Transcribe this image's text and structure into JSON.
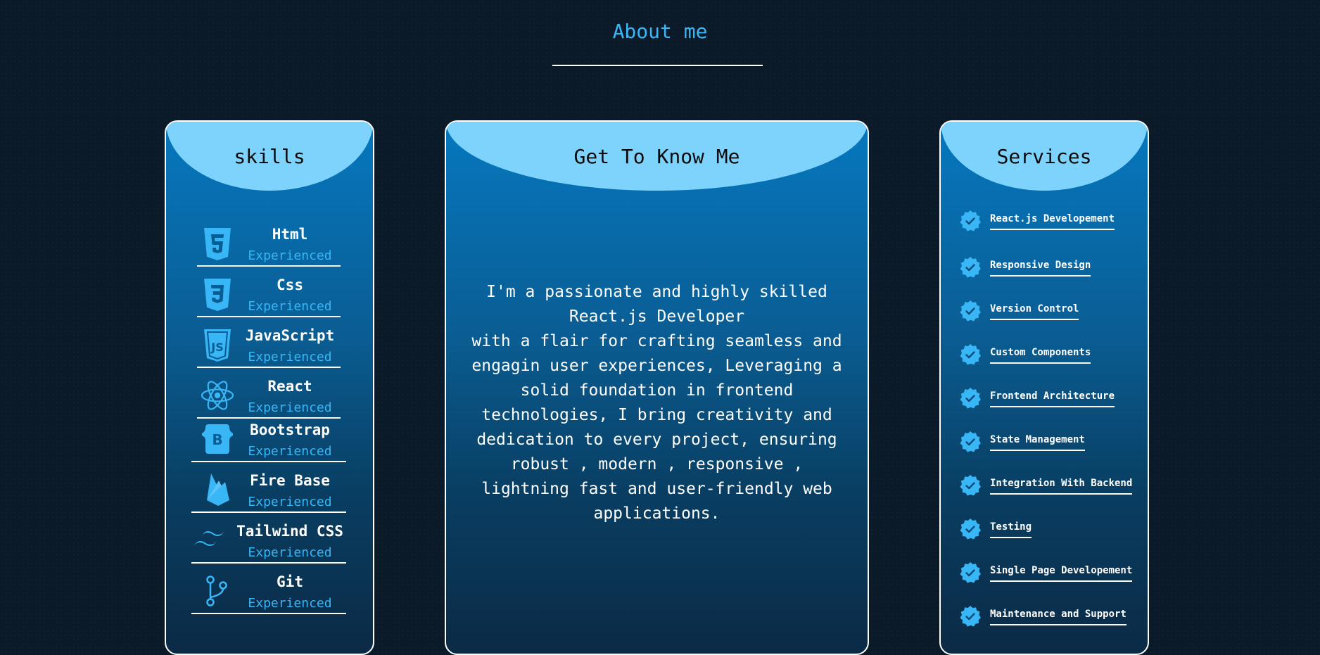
{
  "about": {
    "title": "About me"
  },
  "skills": {
    "title": "skills",
    "items": [
      {
        "name": "Html",
        "level": "Experienced",
        "icon": "html5-icon"
      },
      {
        "name": "Css",
        "level": "Experienced",
        "icon": "css3-icon"
      },
      {
        "name": "JavaScript",
        "level": "Experienced",
        "icon": "javascript-icon"
      },
      {
        "name": "React",
        "level": "Experienced",
        "icon": "react-icon"
      },
      {
        "name": "Bootstrap",
        "level": "Experienced",
        "icon": "bootstrap-icon"
      },
      {
        "name": "Fire Base",
        "level": "Experienced",
        "icon": "firebase-icon"
      },
      {
        "name": "Tailwind CSS",
        "level": "Experienced",
        "icon": "tailwind-icon"
      },
      {
        "name": "Git",
        "level": "Experienced",
        "icon": "git-branch-icon"
      }
    ]
  },
  "know_me": {
    "title": "Get To Know Me",
    "body": "I'm a passionate and highly skilled\nReact.js Developer\nwith a flair for crafting seamless and\nengagin user experiences, Leveraging a\nsolid foundation in frontend\ntechnologies, I bring creativity and\ndedication to every project, ensuring\nrobust , modern , responsive ,\nlightning fast and user-friendly web\napplications."
  },
  "services": {
    "title": "Services",
    "icon": "verified-check-icon",
    "items": [
      "React.js Developement",
      "Responsive Design",
      "Version Control",
      "Custom Components",
      "Frontend Architecture",
      "State Management",
      "Integration With Backend",
      "Testing",
      "Single Page Developement",
      "Maintenance and Support"
    ]
  },
  "colors": {
    "background": "#0b1a29",
    "accent": "#38b6f5",
    "card_header": "#7dd3fc",
    "card_top": "#0678bf"
  }
}
